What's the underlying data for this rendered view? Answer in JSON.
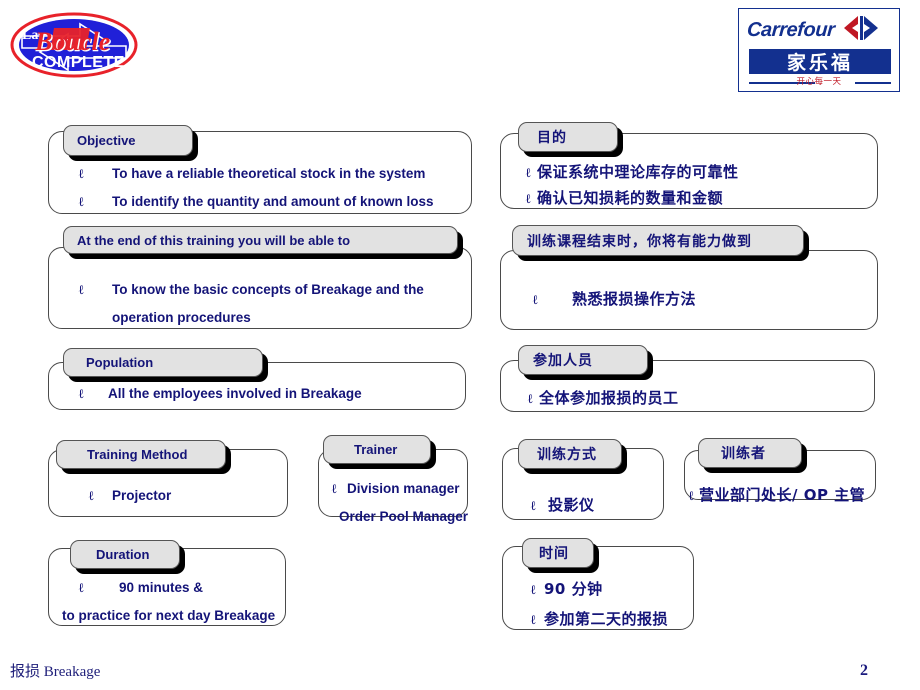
{
  "slide": {
    "page_number": "2",
    "footer": "报损  Breakage",
    "colors": {
      "text_navy": "#141478",
      "tab_fill": "#e2e2e2",
      "carrefour_blue": "#13308f",
      "carrefour_red": "#c01824",
      "boucle_blue": "#2020d8",
      "boucle_red": "#e8222a"
    }
  },
  "logos": {
    "boucle": {
      "name": "la-boucle-complete-logo",
      "line1": "La",
      "line2": "Boucle",
      "line3": "COMPLETE"
    },
    "carrefour": {
      "name": "carrefour-logo",
      "wordmark": "Carrefour",
      "chinese": "家乐福",
      "slogan": "开心每一天"
    }
  },
  "boxes": {
    "objective": {
      "tab": "Objective",
      "items": [
        "To have a reliable theoretical stock in the system",
        "To identify the quantity and amount of  known loss"
      ]
    },
    "able_to": {
      "tab": "At the end of this training you will be able to",
      "items": [
        "To know  the basic concepts of Breakage and the",
        "operation procedures"
      ]
    },
    "population": {
      "tab": "Population",
      "items": [
        "All the employees involved in Breakage"
      ]
    },
    "training_method": {
      "tab": "Training Method",
      "items": [
        "Projector"
      ]
    },
    "trainer": {
      "tab": "Trainer",
      "items": [
        "Division manager",
        "Order Pool  Manager"
      ]
    },
    "duration": {
      "tab": "Duration",
      "items": [
        "90 minutes &",
        "to  practice for next day Breakage"
      ]
    },
    "objective_cn": {
      "tab": "目的",
      "items": [
        "保证系统中理论库存的可靠性",
        "确认已知损耗的数量和金额"
      ]
    },
    "able_to_cn": {
      "tab": "训练课程结束时，你将有能力做到",
      "items": [
        "熟悉报损操作方法"
      ]
    },
    "population_cn": {
      "tab": "参加人员",
      "items": [
        "全体参加报损的员工"
      ]
    },
    "training_method_cn": {
      "tab": "训练方式",
      "items": [
        "投影仪"
      ]
    },
    "trainer_cn": {
      "tab": "训练者",
      "items": [
        "营业部门处长/ OP  主管"
      ]
    },
    "duration_cn": {
      "tab": "时间",
      "items": [
        "90  分钟",
        "参加第二天的报损"
      ]
    }
  }
}
